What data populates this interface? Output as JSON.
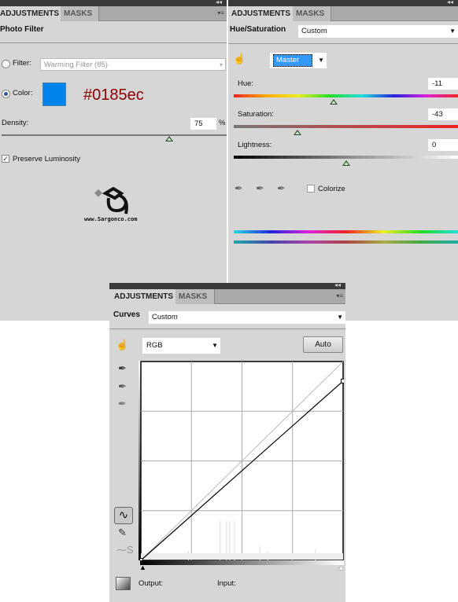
{
  "photo_filter": {
    "tabs": [
      "ADJUSTMENTS",
      "MASKS"
    ],
    "title": "Photo Filter",
    "filter_label": "Filter:",
    "filter_value": "Warming Filter (85)",
    "filter_selected": false,
    "color_label": "Color:",
    "color_selected": true,
    "color_swatch": "#0185ec",
    "color_annotation": "#0185ec",
    "annotation_color": "#8b0000",
    "density_label": "Density:",
    "density_value": "75",
    "density_unit": "%",
    "preserve_label": "Preserve Luminosity",
    "preserve_checked": true,
    "watermark": "www.Sargonco.com"
  },
  "hue_saturation": {
    "tabs": [
      "ADJUSTMENTS",
      "MASKS"
    ],
    "title": "Hue/Saturation",
    "preset": "Custom",
    "channel": "Master",
    "hue_label": "Hue:",
    "hue_value": "-11",
    "saturation_label": "Saturation:",
    "saturation_value": "-43",
    "lightness_label": "Lightness:",
    "lightness_value": "0",
    "colorize_label": "Colorize",
    "colorize_checked": false
  },
  "curves": {
    "tabs": [
      "ADJUSTMENTS",
      "MASKS"
    ],
    "title": "Curves",
    "preset": "Custom",
    "channel": "RGB",
    "auto_label": "Auto",
    "output_label": "Output:",
    "input_label": "Input:",
    "points": [
      [
        0,
        0
      ],
      [
        255,
        230
      ]
    ]
  }
}
